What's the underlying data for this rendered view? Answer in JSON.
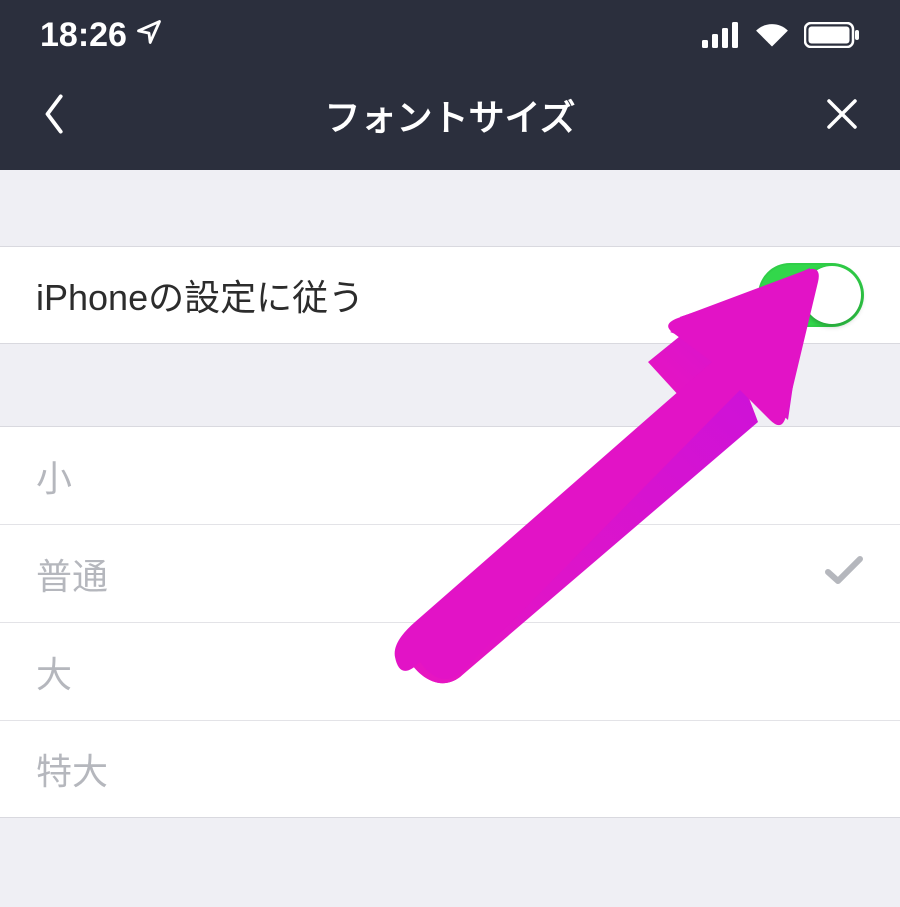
{
  "status_bar": {
    "time": "18:26"
  },
  "header": {
    "title": "フォントサイズ"
  },
  "toggle_row": {
    "label": "iPhoneの設定に従う",
    "on": true
  },
  "options": [
    {
      "label": "小",
      "selected": false
    },
    {
      "label": "普通",
      "selected": true
    },
    {
      "label": "大",
      "selected": false
    },
    {
      "label": "特大",
      "selected": false
    }
  ]
}
